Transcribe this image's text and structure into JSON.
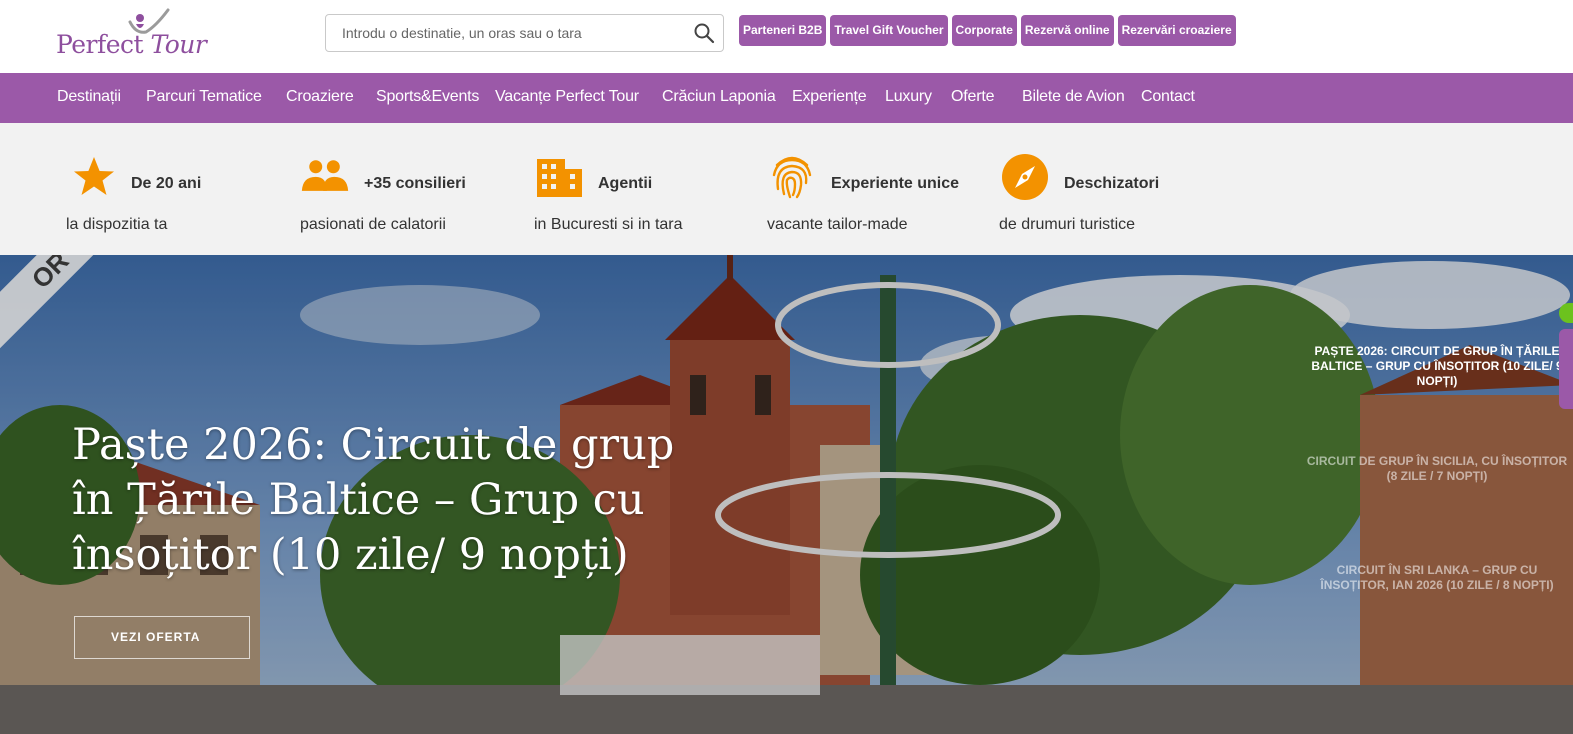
{
  "brand": {
    "name_part1": "Perfect",
    "name_part2": "Tour",
    "accent": "#9b59a8",
    "orange": "#f39200"
  },
  "search": {
    "placeholder": "Introdu o destinatie, un oras sau o tara",
    "icon": "search-icon"
  },
  "top_links": [
    "Parteneri B2B",
    "Travel Gift Voucher",
    "Corporate",
    "Rezervă online",
    "Rezervări croaziere"
  ],
  "nav": [
    "Destinații",
    "Parcuri Tematice",
    "Croaziere",
    "Sports&Events",
    "Vacanțe Perfect Tour",
    "Crăciun Laponia",
    "Experiențe",
    "Luxury",
    "Oferte",
    "Bilete de Avion",
    "Contact"
  ],
  "features": [
    {
      "icon": "star-icon",
      "title": "De 20 ani",
      "subtitle": "la dispozitia ta"
    },
    {
      "icon": "people-icon",
      "title": "+35 consilieri",
      "subtitle": "pasionati de calatorii"
    },
    {
      "icon": "building-icon",
      "title": "Agentii",
      "subtitle": "in Bucuresti si in tara"
    },
    {
      "icon": "fingerprint-icon",
      "title": "Experiente unice",
      "subtitle": "vacante tailor-made"
    },
    {
      "icon": "compass-icon",
      "title": "Deschizatori",
      "subtitle": "de drumuri turistice"
    }
  ],
  "hero": {
    "ribbon": "OR",
    "title": "Paște 2026: Circuit de grup în Țările Baltice – Grup cu însoțitor (10 zile/ 9 nopți)",
    "button": "VEZI OFERTA"
  },
  "slides": [
    "Paște 2026: Circuit de grup în Țările Baltice – Grup cu însoțitor (10 zile/ 9 nopți)",
    "Circuit de grup în Sicilia, cu însoțitor (8 zile / 7 nopți)",
    "Circuit în Sri Lanka – grup cu însoțitor, Ian 2026 (10 zile / 8 nopți)"
  ]
}
